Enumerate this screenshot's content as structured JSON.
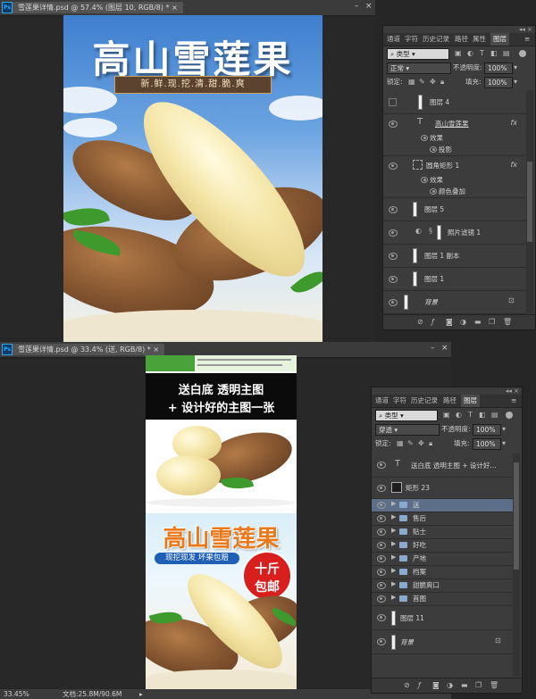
{
  "window1": {
    "tab_title": "雪莲果详情.psd @ 57.4% (图层 10, RGB/8) *",
    "image": {
      "title": "高山雪莲果",
      "ribbon": "新.鲜.现.挖.清.甜.脆.爽"
    }
  },
  "panel1": {
    "tabs": [
      "通道",
      "字符",
      "历史记录",
      "路径",
      "属性",
      "图层"
    ],
    "active_tab": "图层",
    "filter_label": "类型",
    "blend_mode": "正常",
    "opacity_label": "不透明度:",
    "opacity_value": "100%",
    "lock_label": "锁定:",
    "fill_label": "填充:",
    "fill_value": "100%",
    "layers": [
      {
        "name": "图层 4",
        "type": "pixel",
        "visible": false
      },
      {
        "name": "高山雪莲果",
        "type": "text",
        "fx": "fx"
      },
      {
        "name": "效果",
        "type": "effect-header"
      },
      {
        "name": "投影",
        "type": "effect"
      },
      {
        "name": "圆角矩形 1",
        "type": "shape",
        "fx": "fx"
      },
      {
        "name": "效果",
        "type": "effect-header"
      },
      {
        "name": "颜色叠加",
        "type": "effect"
      },
      {
        "name": "图层 5",
        "type": "pixel"
      },
      {
        "name": "照片滤镜 1",
        "type": "adjustment"
      },
      {
        "name": "图层 1 副本",
        "type": "pixel"
      },
      {
        "name": "图层 1",
        "type": "pixel"
      },
      {
        "name": "背景",
        "type": "background"
      }
    ]
  },
  "window2": {
    "tab_title": "雪莲果详情.psd @ 33.4% (送, RGB/8) *",
    "image": {
      "banner_line1": "送白底 透明主图",
      "banner_line2": "+ 设计好的主图一张",
      "title": "高山雪莲果",
      "tagline": "现挖现发 坏果包赔",
      "badge_line1": "十斤",
      "badge_line2": "包邮"
    },
    "status": {
      "zoom": "33.45%",
      "doc_label": "文档:25.8M/90.6M"
    }
  },
  "panel2": {
    "tabs": [
      "通道",
      "字符",
      "历史记录",
      "路径",
      "图层"
    ],
    "active_tab": "图层",
    "filter_label": "类型",
    "blend_mode": "穿透",
    "opacity_label": "不透明度:",
    "opacity_value": "100%",
    "lock_label": "锁定:",
    "fill_label": "填充:",
    "fill_value": "100%",
    "layers": [
      {
        "name": "送白底 透明主图 + 设计好...",
        "type": "text"
      },
      {
        "name": "矩形 23",
        "type": "shape"
      },
      {
        "name": "送",
        "type": "group",
        "selected": true
      },
      {
        "name": "售后",
        "type": "group"
      },
      {
        "name": "贴士",
        "type": "group"
      },
      {
        "name": "好吃",
        "type": "group"
      },
      {
        "name": "产地",
        "type": "group"
      },
      {
        "name": "档案",
        "type": "group"
      },
      {
        "name": "甜脆爽口",
        "type": "group"
      },
      {
        "name": "首图",
        "type": "group"
      },
      {
        "name": "图层 11",
        "type": "pixel"
      },
      {
        "name": "背景",
        "type": "background"
      }
    ]
  }
}
